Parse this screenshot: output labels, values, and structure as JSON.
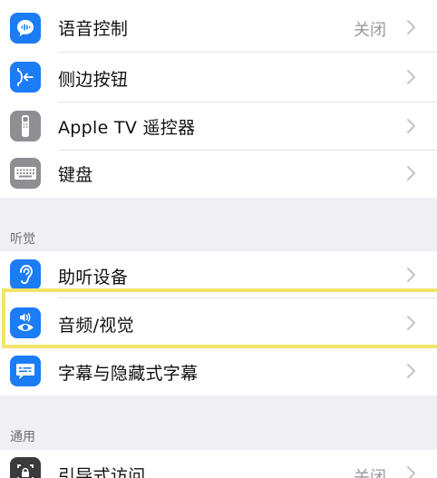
{
  "section1": {
    "items": [
      {
        "label": "语音控制",
        "value": "关闭",
        "icon": "voice-control-icon",
        "color": "#1b7cf3"
      },
      {
        "label": "侧边按钮",
        "value": "",
        "icon": "side-button-icon",
        "color": "#1b7cf3"
      },
      {
        "label": "Apple TV 遥控器",
        "value": "",
        "icon": "apple-tv-remote-icon",
        "color": "#8e8e93"
      },
      {
        "label": "键盘",
        "value": "",
        "icon": "keyboard-icon",
        "color": "#8e8e93"
      }
    ]
  },
  "section2": {
    "header": "听觉",
    "items": [
      {
        "label": "助听设备",
        "value": "",
        "icon": "ear-icon",
        "color": "#1b7cf3"
      },
      {
        "label": "音频/视觉",
        "value": "",
        "icon": "audio-visual-icon",
        "color": "#1b7cf3"
      },
      {
        "label": "字幕与隐藏式字幕",
        "value": "",
        "icon": "subtitles-icon",
        "color": "#1b7cf3"
      }
    ]
  },
  "section3": {
    "header": "通用",
    "items": [
      {
        "label": "引导式访问",
        "value": "关闭",
        "icon": "guided-access-icon",
        "color": "#3a3a3c"
      }
    ]
  },
  "highlight_color": "#f2e46a"
}
